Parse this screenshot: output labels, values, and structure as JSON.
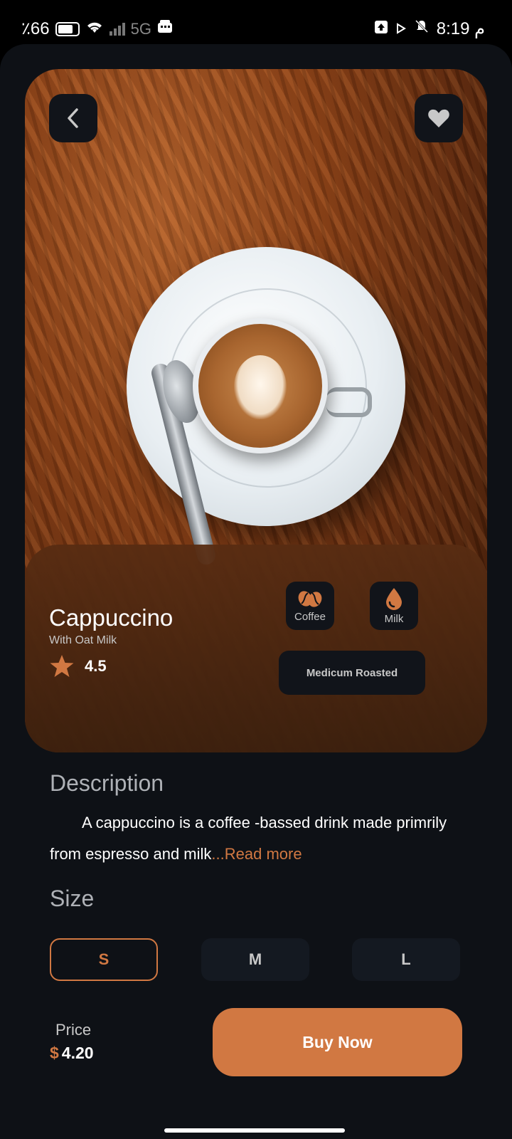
{
  "status_bar": {
    "battery": "٪66",
    "network": "5G",
    "time": "8:19 م"
  },
  "product": {
    "name": "Cappuccino",
    "subtitle": "With Oat Milk",
    "rating": "4.5",
    "tags": [
      {
        "label": "Coffee",
        "icon": "coffee-beans-icon"
      },
      {
        "label": "Milk",
        "icon": "milk-drop-icon"
      }
    ],
    "roast": "Medicum Roasted"
  },
  "description": {
    "title": "Description",
    "text": "A cappuccino is a coffee -bassed drink made primrily from espresso and milk",
    "read_more": "...Read more"
  },
  "size": {
    "title": "Size",
    "options": [
      "S",
      "M",
      "L"
    ],
    "selected": "S"
  },
  "price": {
    "label": "Price",
    "currency": "$",
    "value": "4.20"
  },
  "buy_label": "Buy Now",
  "colors": {
    "accent": "#d17842",
    "background": "#0e1116",
    "chip": "#11141a"
  }
}
